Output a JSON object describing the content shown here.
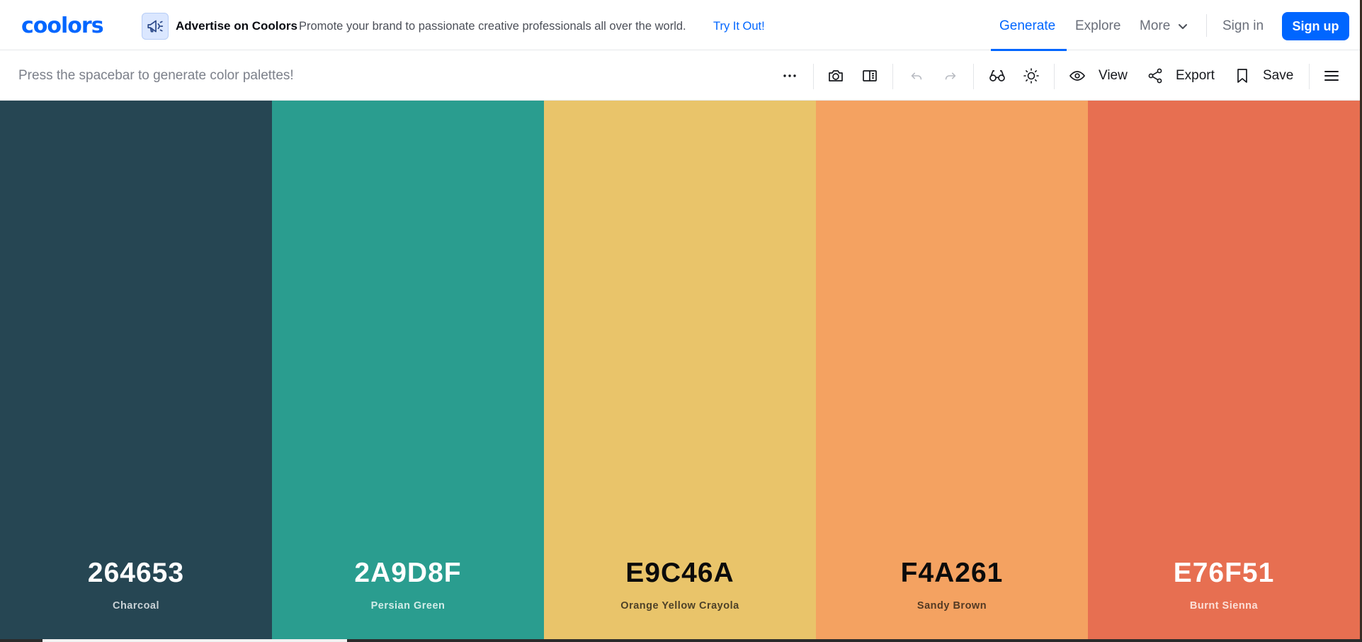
{
  "brand": {
    "logo": "coolors"
  },
  "ad": {
    "title": "Advertise on Coolors",
    "text": "Promote your brand to passionate creative professionals all over the world.",
    "link": "Try It Out!"
  },
  "nav": {
    "generate": "Generate",
    "explore": "Explore",
    "more": "More",
    "signin": "Sign in",
    "signup": "Sign up"
  },
  "toolbar": {
    "hint": "Press the spacebar to generate color palettes!",
    "view": "View",
    "export": "Export",
    "save": "Save"
  },
  "palette": [
    {
      "hex": "264653",
      "name": "Charcoal",
      "color": "#264653",
      "text_color": "#ffffff",
      "name_color": "#c9d2d6"
    },
    {
      "hex": "2A9D8F",
      "name": "Persian Green",
      "color": "#2a9d8f",
      "text_color": "#ffffff",
      "name_color": "#d2ece8"
    },
    {
      "hex": "E9C46A",
      "name": "Orange Yellow Crayola",
      "color": "#e9c46a",
      "text_color": "#0b0b0b",
      "name_color": "#4d4128"
    },
    {
      "hex": "F4A261",
      "name": "Sandy Brown",
      "color": "#f4a261",
      "text_color": "#0b0b0b",
      "name_color": "#533a24"
    },
    {
      "hex": "E76F51",
      "name": "Burnt Sienna",
      "color": "#e76f51",
      "text_color": "#ffffff",
      "name_color": "#fbe0d8"
    }
  ],
  "colors": {
    "accent": "#0066ff"
  }
}
